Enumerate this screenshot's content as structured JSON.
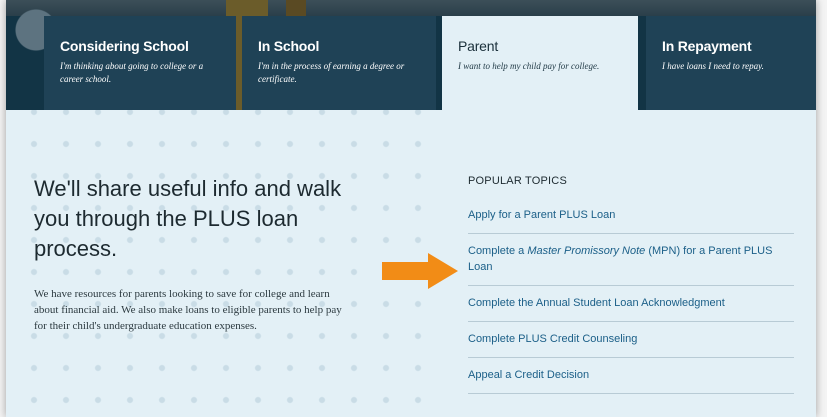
{
  "tabs": [
    {
      "title": "Considering School",
      "desc": "I'm thinking about going to college or a career school."
    },
    {
      "title": "In School",
      "desc": "I'm in the process of earning a degree or certificate."
    },
    {
      "title": "Parent",
      "desc": "I want to help my child pay for college."
    },
    {
      "title": "In Repayment",
      "desc": "I have loans I need to repay."
    }
  ],
  "active_tab": "Parent",
  "main": {
    "headline": "We'll share useful info and walk you through the PLUS loan process.",
    "body": "We have resources for parents looking to save for college and learn about financial aid. We also make loans to eligible parents to help pay for their child's undergraduate education expenses."
  },
  "popular": {
    "heading": "POPULAR TOPICS",
    "items": {
      "apply": "Apply for a Parent PLUS Loan",
      "mpn_pre": "Complete a ",
      "mpn_em": "Master Promissory Note",
      "mpn_post": " (MPN) for a Parent PLUS Loan",
      "annual": "Complete the Annual Student Loan Acknowledgment",
      "counseling": "Complete PLUS Credit Counseling",
      "appeal": "Appeal a Credit Decision"
    }
  },
  "colors": {
    "nav_bg": "#123445",
    "tab_bg": "#1f4256",
    "content_bg": "#e3f0f6",
    "link": "#1b5f88",
    "arrow": "#f28c16"
  },
  "icons": {
    "annotation_arrow": "arrow-right-icon"
  }
}
